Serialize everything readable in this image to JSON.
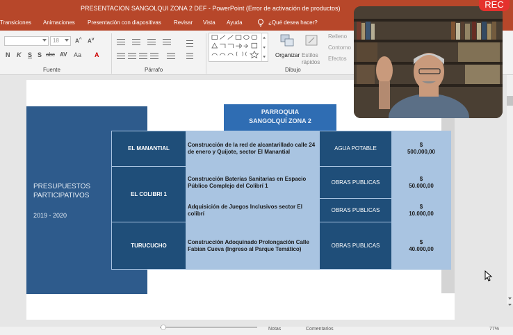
{
  "window": {
    "title": "PRESENTACION  SANGOLQUI ZONA 2 DEF  -  PowerPoint (Error de activación de productos)"
  },
  "ribbon": {
    "tabs": [
      "Transiciones",
      "Animaciones",
      "Presentación con diapositivas",
      "Revisar",
      "Vista",
      "Ayuda",
      "¿Qué desea hacer?"
    ],
    "font_size": "18",
    "font_buttons": [
      "N",
      "K",
      "S",
      "S",
      "abc",
      "AV",
      "Aa",
      "A"
    ],
    "group_labels": {
      "fuente": "Fuente",
      "parrafo": "Párrafo",
      "dibujo": "Dibujo"
    },
    "organize_label": "Organizar",
    "styles_label": "Estilos rápidos",
    "format_items": [
      "Relleno",
      "Contorno",
      "Efectos"
    ]
  },
  "slide": {
    "left_panel": {
      "line1": "PRESUPUESTOS",
      "line2": "PARTICIPATIVOS",
      "years": "2019 - 2020"
    },
    "header": {
      "line1": "PARROQUIA",
      "line2": "SANGOLQUÍ ZONA 2"
    },
    "rows": [
      {
        "name": "EL MANANTIAL",
        "description": "Construcción de la red de alcantarillado calle 24 de enero y Quijote, sector El Manantial",
        "category": "AGUA POTABLE",
        "currency": "$",
        "amount": "500.000,00"
      },
      {
        "name": "EL COLIBRI 1",
        "description": "Construcción Baterías Sanitarias en Espacio Público Complejo del Colibrí 1",
        "category": "OBRAS PUBLICAS",
        "currency": "$",
        "amount": "50.000,00"
      },
      {
        "name": "",
        "description": "Adquisición de Juegos Inclusivos sector El colibrí",
        "category": "OBRAS PUBLICAS",
        "currency": "$",
        "amount": "10.000,00"
      },
      {
        "name": "TURUCUCHO",
        "description": "Construcción Adoquinado Prolongación Calle Fabian Cueva (Ingreso al Parque Temático)",
        "category": "OBRAS PUBLICAS",
        "currency": "$",
        "amount": "40.000,00"
      }
    ]
  },
  "webcam": {
    "rec_label": "REC"
  },
  "statusbar": {
    "notes": "Notas",
    "comments": "Comentarios",
    "zoom": "77%"
  },
  "colors": {
    "accent": "#b7472a",
    "slide_dark_blue": "#2e5b8c",
    "header_blue": "#2f6db3",
    "table_dark": "#1f4e79",
    "table_light": "#a9c4e1",
    "rec_red": "#e5312d"
  }
}
